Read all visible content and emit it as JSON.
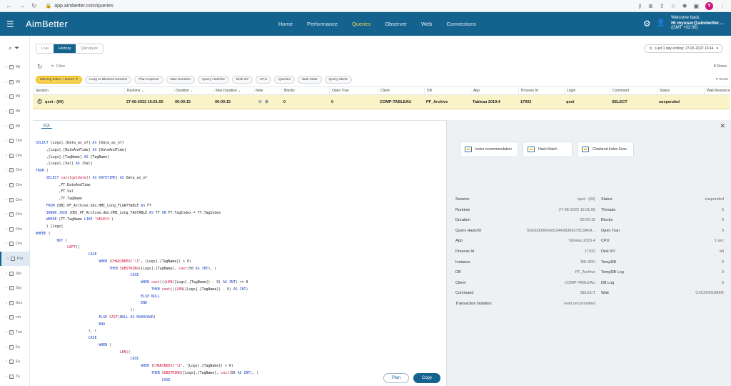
{
  "browser": {
    "url": "app.aimbetter.com/queries",
    "avatar": "Y"
  },
  "app": {
    "logo": "AimBetter",
    "nav": [
      "Home",
      "Performance",
      "Queries",
      "Observer",
      "Web",
      "Connections"
    ],
    "active_nav": "Queries",
    "welcome": "Welcome back,",
    "user": "Hi myuser@aimbetter....",
    "timezone": "(GMT +02:00)"
  },
  "sidebar": {
    "items": [
      "Wi",
      "Wi",
      "Wi",
      "Wi",
      "Wi",
      "Ore",
      "Ore",
      "Ore",
      "Ore",
      "Ore",
      "Ore",
      "Ore",
      "Ore",
      "Pro",
      "Sto",
      "Sql",
      "Sec",
      "vm",
      "Tuo",
      "Ex",
      "Ex",
      "Ta"
    ],
    "active_index": 13
  },
  "tabs": {
    "live": "Live",
    "history": "History",
    "qanalyze": "QAnalyze"
  },
  "range_label": "Last 1 day ending: 27-06-2022 16:44",
  "filter_label": "Filter",
  "rows_label": "8 Rows",
  "reset_label": "Reset",
  "chips": [
    "Missing Index + Execs",
    "Long or Blocked Session",
    "Plan Improve",
    "Max Duration",
    "Query Hash/ID",
    "Disk I/O",
    "CPU",
    "Queries",
    "Wait Stats",
    "Query alerts"
  ],
  "columns": [
    "Session",
    "Runtime",
    "Duration",
    "Max Duration",
    "Note",
    "Blocks",
    "Open Tran",
    "Client",
    "DB",
    "App",
    "Process Id",
    "Login",
    "Command",
    "Status",
    "Wait Resource"
  ],
  "row": {
    "session": "qset - (60)",
    "runtime": "27-06-2022 16:01:00",
    "duration": "00:00:15",
    "max_duration": "00:00:15",
    "blocks": "0",
    "open_tran": "0",
    "client": "COMP-TABLEAU",
    "db": "PF_Archive",
    "app": "Tableau 2019.4",
    "process_id": "17932",
    "login": "qset",
    "command": "SELECT",
    "status": "suspended"
  },
  "sql_tab": "SQL",
  "plan_label": "Plan",
  "copy_label": "Copy",
  "recommendations": [
    "Index recommendation",
    "Hash Match",
    "Clustered Index Scan"
  ],
  "details_left": [
    {
      "k": "Session",
      "v": "qset - (60)"
    },
    {
      "k": "Runtime",
      "v": "27-06-2022 16:01:00"
    },
    {
      "k": "Duration",
      "v": "00:00:15"
    },
    {
      "k": "Query Hash/ID",
      "v": "0x0200000042D34A38366275C9A04..."
    },
    {
      "k": "App",
      "v": "Tableau 2019.4"
    },
    {
      "k": "Process Id",
      "v": "17932"
    },
    {
      "k": "Instance",
      "v": "DB-SRV"
    },
    {
      "k": "DB",
      "v": "PF_Archive"
    },
    {
      "k": "Client",
      "v": "COMP-TABLEAU"
    },
    {
      "k": "Command",
      "v": "SELECT"
    },
    {
      "k": "Transaction Isolation",
      "v": "read uncommitted"
    }
  ],
  "details_right": [
    {
      "k": "Status",
      "v": "suspended"
    },
    {
      "k": "Threads",
      "v": "5"
    },
    {
      "k": "Blocks",
      "v": "0"
    },
    {
      "k": "Open Tran",
      "v": "0"
    },
    {
      "k": "CPU",
      "v": "1 sec"
    },
    {
      "k": "Disk I/O",
      "v": "bit"
    },
    {
      "k": "TempDB",
      "v": "0"
    },
    {
      "k": "TempDB Log",
      "v": "0"
    },
    {
      "k": "DB Log",
      "v": "0"
    },
    {
      "k": "Wait",
      "v": "CXCONSUMER"
    }
  ],
  "sql_lines": [
    "SELECT [Logs].[Data_as_of] AS [Data_as_of]",
    "     ,[Logs].[DateAndTime] AS [DateAndTime]",
    "     ,[Logs].[TagName] AS [TagName]",
    "     ,[Logs].[Val] AS [Val]",
    "FROM (",
    "     SELECT cast(getdate() AS DATETIME) AS Data_as_of",
    "           ,FT.DateAndTime",
    "           ,FT.Val",
    "           ,TT.TagName",
    "     FROM [DB].PF_Archive.dbo.HMI_Long_FLOATTABLE AS FT",
    "     INNER JOIN [DB].PF_Archive.dbo.HMI_Long_TAGTABLE AS TT ON FT.TagIndex = TT.TagIndex",
    "     WHERE (TT.TagName LIKE '%ELEC%')",
    "     ) [Logs]",
    "WHERE (",
    "          NOT (",
    "               LEFT((",
    "                         CASE",
    "                              WHEN (CHARINDEX('\\I', [Logs].[TagName]) > 0)",
    "                                   THEN SUBSTRING([Logs].[TagName], cast(50 AS INT), (",
    "                                             CASE",
    "                                                  WHEN cast(((LEN([Logs].[TagName]) - 9) AS INT) >= 0",
    "                                                       THEN cast(((LEN([Logs].[TagName]) - 9) AS INT)",
    "                                                  ELSE NULL",
    "                                                  END",
    "                                             ))",
    "                              ELSE CAST(NULL AS NVARCHAR)",
    "                              END",
    "                         ), (",
    "                         CASE",
    "                              WHEN (",
    "                                        LEN((",
    "                                             CASE",
    "                                                  WHEN (CHARINDEX('\\I', [Logs].[TagName]) > 0)",
    "                                                       THEN SUBSTRING([Logs].[TagName], cast(50 AS INT), (",
    "                                                            CASE"
  ]
}
